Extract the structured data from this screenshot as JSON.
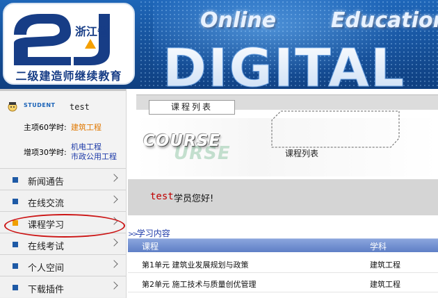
{
  "header": {
    "logo_province": "浙江省",
    "logo_name": "二级建造师继续教育",
    "banner_word1": "Online",
    "banner_word2": "Education",
    "banner_word3": "DIGITAL"
  },
  "user": {
    "tag": "STUDENT",
    "username": "test",
    "main_hours_label": "主项60学时:",
    "main_hours_value": "建筑工程",
    "add_hours_label": "增项30学时:",
    "add_hours_values": [
      "机电工程",
      "市政公用工程"
    ]
  },
  "nav": {
    "items": [
      {
        "label": "新闻通告",
        "active": false
      },
      {
        "label": "在线交流",
        "active": false
      },
      {
        "label": "课程学习",
        "active": true
      },
      {
        "label": "在线考试",
        "active": false
      },
      {
        "label": "个人空间",
        "active": false
      },
      {
        "label": "下载插件",
        "active": false
      }
    ]
  },
  "main": {
    "page_tab": "课程列表",
    "course_banner_word": "COURSE",
    "course_banner_word2": "URSE",
    "course_banner_label": "课程列表",
    "welcome_name": "test",
    "welcome_text": "学员您好!",
    "study_header": "学习内容",
    "table": {
      "headers": [
        "课程",
        "学科"
      ],
      "rows": [
        [
          "第1单元 建筑业发展规划与政策",
          "建筑工程"
        ],
        [
          "第2单元 施工技术与质量创优管理",
          "建筑工程"
        ]
      ]
    }
  },
  "colors": {
    "accent_blue": "#1e5aa6",
    "active_orange": "#f0a000",
    "highlight_red": "#cc1515",
    "table_header": "#6f8fd2"
  }
}
